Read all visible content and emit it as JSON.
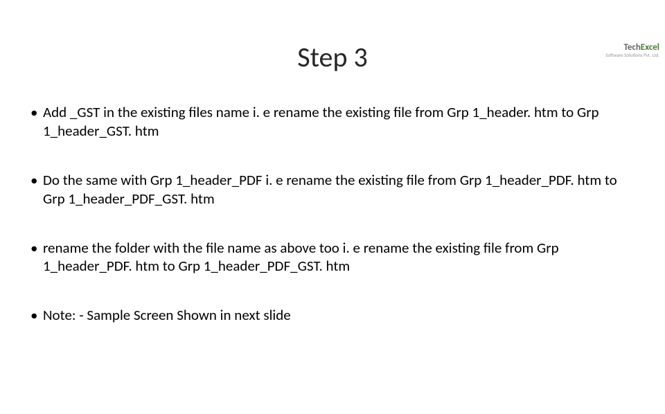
{
  "logo": {
    "brand_part1": "Tech",
    "brand_part2": "Excel",
    "tagline": "Software Solutions Pvt. Ltd."
  },
  "title": "Step 3",
  "bullets": [
    "Add _GST in the existing files name i. e rename the existing file from Grp 1_header. htm to Grp 1_header_GST. htm",
    "Do the same with Grp 1_header_PDF i. e rename the existing file from Grp 1_header_PDF. htm to Grp 1_header_PDF_GST. htm",
    "rename the folder with the file name as above too i. e  rename the existing file from Grp 1_header_PDF. htm to Grp 1_header_PDF_GST. htm",
    "Note: - Sample Screen Shown in next slide"
  ]
}
